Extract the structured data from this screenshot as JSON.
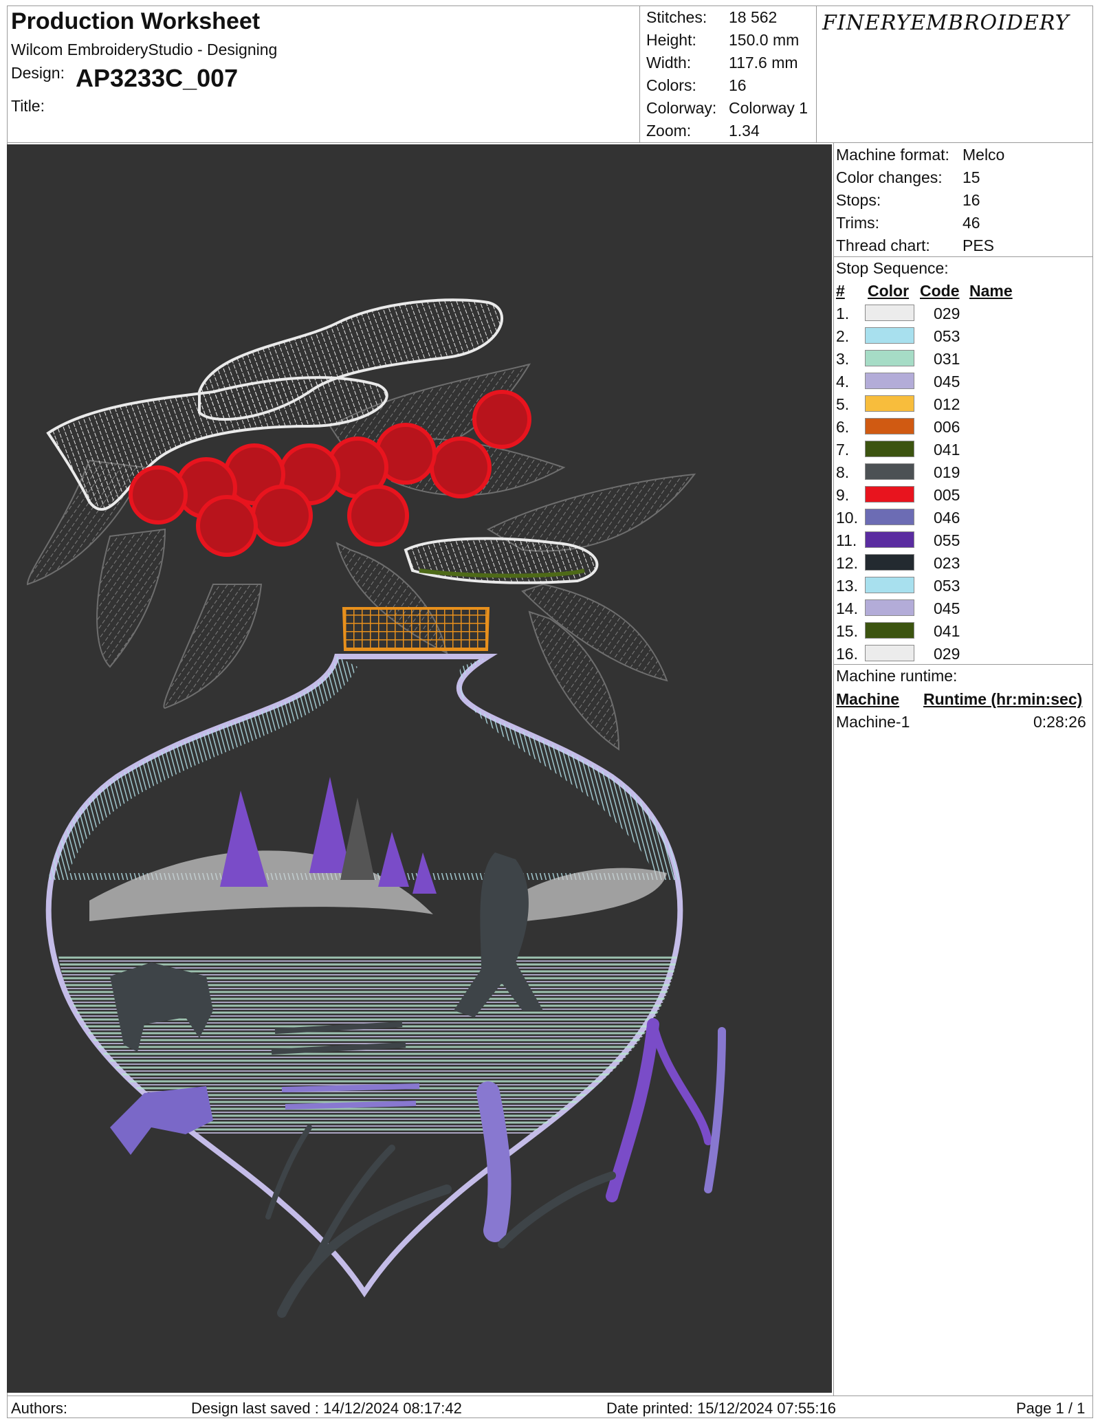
{
  "header": {
    "title": "Production Worksheet",
    "app": "Wilcom EmbroideryStudio - Designing",
    "design_label": "Design:",
    "design_name": "AP3233C_007",
    "title_label": "Title:",
    "brand": "FINERYEMBROIDERY"
  },
  "stats": [
    {
      "label": "Stitches:",
      "value": "18 562"
    },
    {
      "label": "Height:",
      "value": "150.0 mm"
    },
    {
      "label": "Width:",
      "value": "117.6 mm"
    },
    {
      "label": "Colors:",
      "value": "16"
    },
    {
      "label": "Colorway:",
      "value": "Colorway 1"
    },
    {
      "label": "Zoom:",
      "value": "1.34"
    }
  ],
  "machine_info": [
    {
      "label": "Machine format:",
      "value": "Melco"
    },
    {
      "label": "Color changes:",
      "value": "15"
    },
    {
      "label": "Stops:",
      "value": "16"
    },
    {
      "label": "Trims:",
      "value": "46"
    },
    {
      "label": "Thread chart:",
      "value": "PES"
    }
  ],
  "stop_sequence": {
    "heading": "Stop Sequence:",
    "columns": {
      "num": "#",
      "color": "Color",
      "code": "Code",
      "name": "Name"
    },
    "rows": [
      {
        "num": "1.",
        "color": "#ececec",
        "code": "029"
      },
      {
        "num": "2.",
        "color": "#a8e0ee",
        "code": "053"
      },
      {
        "num": "3.",
        "color": "#a6dcc6",
        "code": "031"
      },
      {
        "num": "4.",
        "color": "#b3acd8",
        "code": "045"
      },
      {
        "num": "5.",
        "color": "#f8bd3c",
        "code": "012"
      },
      {
        "num": "6.",
        "color": "#d05a12",
        "code": "006"
      },
      {
        "num": "7.",
        "color": "#3c5410",
        "code": "041"
      },
      {
        "num": "8.",
        "color": "#4c5154",
        "code": "019"
      },
      {
        "num": "9.",
        "color": "#e8141e",
        "code": "005"
      },
      {
        "num": "10.",
        "color": "#6c6cb4",
        "code": "046"
      },
      {
        "num": "11.",
        "color": "#5a2ca0",
        "code": "055"
      },
      {
        "num": "12.",
        "color": "#232a30",
        "code": "023"
      },
      {
        "num": "13.",
        "color": "#a8e0ee",
        "code": "053"
      },
      {
        "num": "14.",
        "color": "#b3acd8",
        "code": "045"
      },
      {
        "num": "15.",
        "color": "#3c5410",
        "code": "041"
      },
      {
        "num": "16.",
        "color": "#ececec",
        "code": "029"
      }
    ]
  },
  "runtime": {
    "heading": "Machine runtime:",
    "col_machine": "Machine",
    "col_runtime": "Runtime (hr:min:sec)",
    "machine": "Machine-1",
    "time": "0:28:26"
  },
  "footer": {
    "authors": "Authors:",
    "saved": "Design last saved : 14/12/2024 08:17:42",
    "printed": "Date printed: 15/12/2024 07:55:16",
    "page": "Page 1 / 1"
  },
  "colors": {
    "canvas_bg": "#333333",
    "cloud": "#e8e8e8",
    "berry": "#e8141e",
    "leaf": "#6a6a6a",
    "ornament_outline": "#c4bce8",
    "snow": "#b4e2ea",
    "tree": "#7a4cc8",
    "dark_figure": "#3e4448",
    "cap": "#e8901c"
  }
}
